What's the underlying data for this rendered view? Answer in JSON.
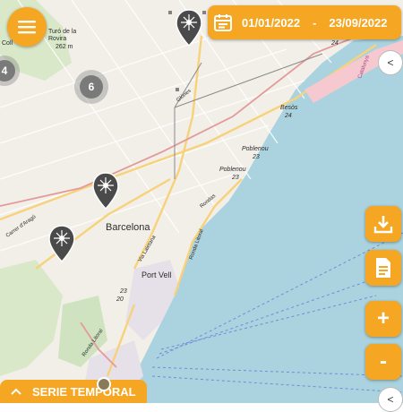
{
  "date_range": {
    "start": "01/01/2022",
    "separator": "-",
    "end": "23/09/2022"
  },
  "clusters": [
    {
      "count": "4"
    },
    {
      "count": "6"
    }
  ],
  "buttons": {
    "zoom_in": "+",
    "zoom_out": "-",
    "collapse_top": "<",
    "collapse_bottom": "<"
  },
  "serie_temporal": {
    "label": "SERIE TEMPORAL"
  },
  "map_labels": {
    "turo": "Turó de la Rovira",
    "turo_elev": "262 m",
    "coll": "Coll",
    "barcelona": "Barcelona",
    "port_vell": "Port Vell",
    "poblenou": "Poblenou",
    "poblenou_num": "23",
    "poblenou2": "Poblenou",
    "poblenou2_num": "23",
    "besos": "Besòs",
    "besos_num": "24",
    "num_24": "24",
    "glories": "Glòries",
    "diagonal": "Avinguda Diagonal",
    "carrer_arago": "Carrer d'Aragó",
    "via_laietana": "Via Laietana",
    "catalunya": "Catalunya",
    "ronda_litoral": "Ronda Litoral",
    "rondas": "Rondas",
    "ronda_litoral2": "Ronda Litoral",
    "num_23": "23",
    "num_20": "20"
  },
  "colors": {
    "accent": "#f5a623",
    "sea": "#aad3df",
    "land": "#f2efe9"
  }
}
